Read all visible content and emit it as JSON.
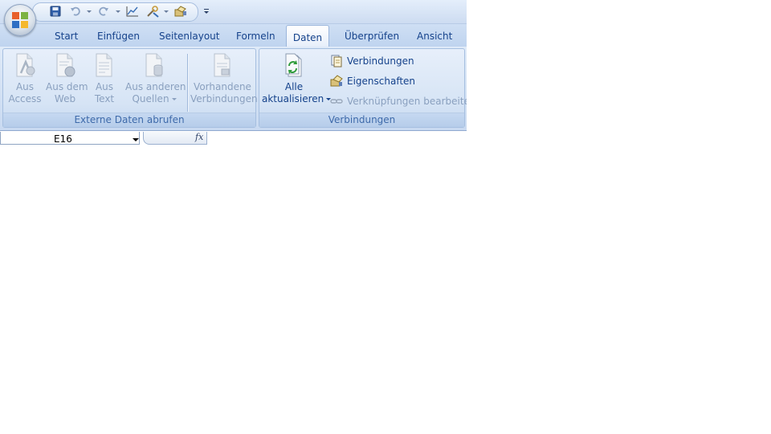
{
  "tabs": [
    {
      "label": "Start"
    },
    {
      "label": "Einfügen"
    },
    {
      "label": "Seitenlayout"
    },
    {
      "label": "Formeln"
    },
    {
      "label": "Daten",
      "active": true
    },
    {
      "label": "Überprüfen"
    },
    {
      "label": "Ansicht"
    }
  ],
  "groups": {
    "external": {
      "label": "Externe Daten abrufen",
      "buttons": [
        {
          "line1": "Aus",
          "line2": "Access",
          "icon": "access-database-icon",
          "enabled": false
        },
        {
          "line1": "Aus dem",
          "line2": "Web",
          "icon": "web-query-icon",
          "enabled": false
        },
        {
          "line1": "Aus",
          "line2": "Text",
          "icon": "text-file-icon",
          "enabled": false
        },
        {
          "line1": "Aus anderen",
          "line2": "Quellen",
          "icon": "other-sources-icon",
          "enabled": false,
          "dropdown": true
        },
        {
          "line1": "Vorhandene",
          "line2": "Verbindungen",
          "icon": "existing-connections-icon",
          "enabled": false
        }
      ]
    },
    "connections": {
      "label": "Verbindungen",
      "refresh": {
        "line1": "Alle",
        "line2": "aktualisieren",
        "icon": "refresh-all-icon",
        "enabled": true,
        "dropdown": true
      },
      "items": [
        {
          "label": "Verbindungen",
          "icon": "connections-icon",
          "enabled": true
        },
        {
          "label": "Eigenschaften",
          "icon": "properties-icon",
          "enabled": true
        },
        {
          "label": "Verknüpfungen bearbeiten",
          "icon": "edit-links-icon",
          "enabled": false
        }
      ]
    }
  },
  "formula_bar": {
    "name_box": "E16",
    "fx": "fx"
  },
  "colors": {
    "tab_text": "#15428b",
    "disabled_text": "#8aa0bf",
    "group_label": "#3e6aaa"
  }
}
